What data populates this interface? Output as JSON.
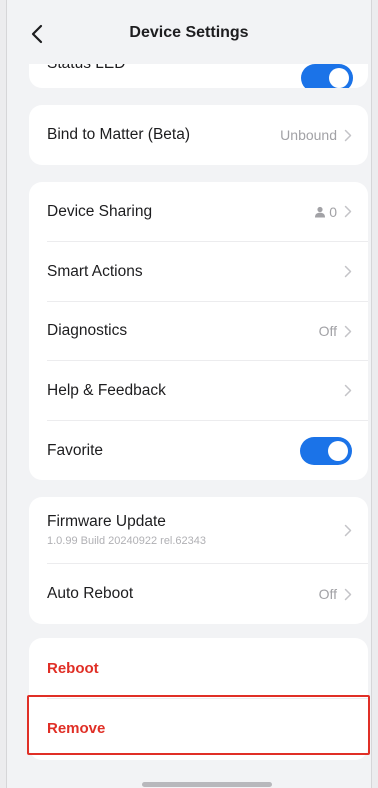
{
  "header": {
    "title": "Device Settings"
  },
  "status_led": {
    "label": "Status LED",
    "enabled": true
  },
  "matter": {
    "label": "Bind to Matter (Beta)",
    "value": "Unbound"
  },
  "main_list": {
    "device_sharing": {
      "label": "Device Sharing",
      "value": "0"
    },
    "smart_actions": {
      "label": "Smart Actions"
    },
    "diagnostics": {
      "label": "Diagnostics",
      "value": "Off"
    },
    "help": {
      "label": "Help & Feedback"
    },
    "favorite": {
      "label": "Favorite",
      "enabled": true
    }
  },
  "firmware": {
    "label": "Firmware Update",
    "version": "1.0.99 Build 20240922 rel.62343"
  },
  "auto_reboot": {
    "label": "Auto Reboot",
    "value": "Off"
  },
  "actions": {
    "reboot_label": "Reboot",
    "remove_label": "Remove"
  },
  "colors": {
    "accent": "#1b73e8",
    "danger": "#e02f26",
    "background": "#f2f3f5",
    "card": "#ffffff"
  }
}
